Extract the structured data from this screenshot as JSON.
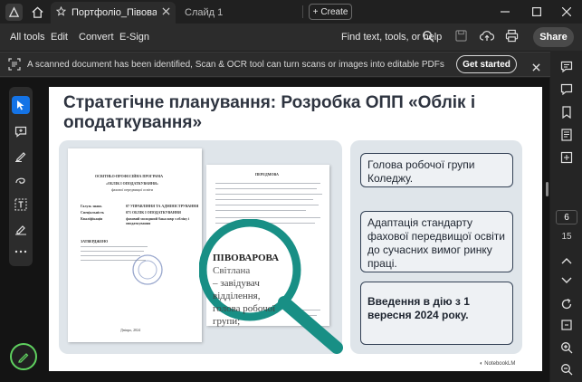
{
  "titlebar": {
    "tab_active": "Портфоліо_Півоварова...",
    "tab_inactive": "Слайд 1",
    "create_label": "Create"
  },
  "menu": {
    "items": [
      "All tools",
      "Edit",
      "Convert",
      "E-Sign"
    ],
    "find_text": "Find text, tools, or help",
    "share_label": "Share"
  },
  "notification": {
    "text": "A scanned document has been identified, Scan & OCR tool can turn scans or images into editable PDFs",
    "button": "Get started"
  },
  "slide": {
    "title": "Стратегічне планування: Розробка ОПП «Облік і оподаткування»",
    "boxes": [
      "Голова робочої групи Коледжу.",
      "Адаптація стандарту фахової передвищої освіти до сучасних вимог ринку праці.",
      "Введення в дію з 1 вересня 2024 року."
    ],
    "magnifier": {
      "name": "ПІВОВАРОВА",
      "line1": "Світлана",
      "line2": "– завідувач відділення,",
      "line3": "голова робочої групи;"
    },
    "doc1": {
      "h1": "ОСВІТНЬО-ПРОФЕСІЙНА ПРОГРАМА",
      "h2": "«ОБЛІК І ОПОДАТКУВАННЯ»",
      "h3": "фахової передвищої освіти",
      "r1a": "Галузь знань",
      "r1b": "07 УПРАВЛІННЯ ТА АДМІНІСТРУВАННЯ",
      "r2a": "Спеціальність",
      "r2b": "071 ОБЛІК І ОПОДАТКУВАННЯ",
      "r3a": "Кваліфікація",
      "r3b": "фаховий молодший бакалавр з обліку і оподаткування",
      "approved": "ЗАТВЕРДЖЕНО",
      "city": "Дніпро, 2024"
    },
    "doc2": {
      "heading": "ПЕРЕДМОВА"
    },
    "brand": "NotebookLM"
  },
  "right_panel": {
    "page_current": "6",
    "page_total": "15"
  }
}
